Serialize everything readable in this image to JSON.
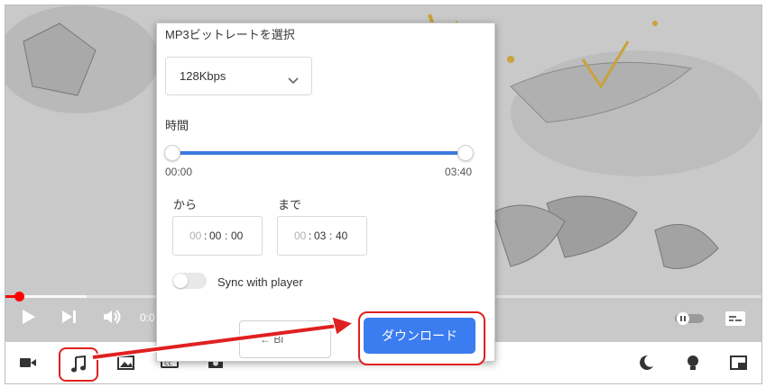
{
  "popup": {
    "bitrate_title": "MP3ビットレートを選択",
    "bitrate_value": "128Kbps",
    "time_title": "時間",
    "range_start": "00:00",
    "range_end": "03:40",
    "from_label": "から",
    "to_label": "まで",
    "from_time": {
      "hh": "00",
      "mm": "00",
      "ss": "00"
    },
    "to_time": {
      "hh": "00",
      "mm": "03",
      "ss": "40"
    },
    "sync_label": "Sync with player",
    "sync_enabled": false,
    "cancel_label": "← Bi",
    "download_label": "ダウンロード"
  },
  "player": {
    "current_time": "0:0",
    "progress_color": "#ff0000"
  },
  "colors": {
    "accent": "#3b7cf0",
    "highlight": "#e02020"
  },
  "toolbar_icons": [
    "video-camera-icon",
    "music-note-icon",
    "image-icon",
    "cc-icon",
    "camera-icon",
    "moon-icon",
    "lightbulb-icon",
    "picture-in-picture-icon"
  ]
}
